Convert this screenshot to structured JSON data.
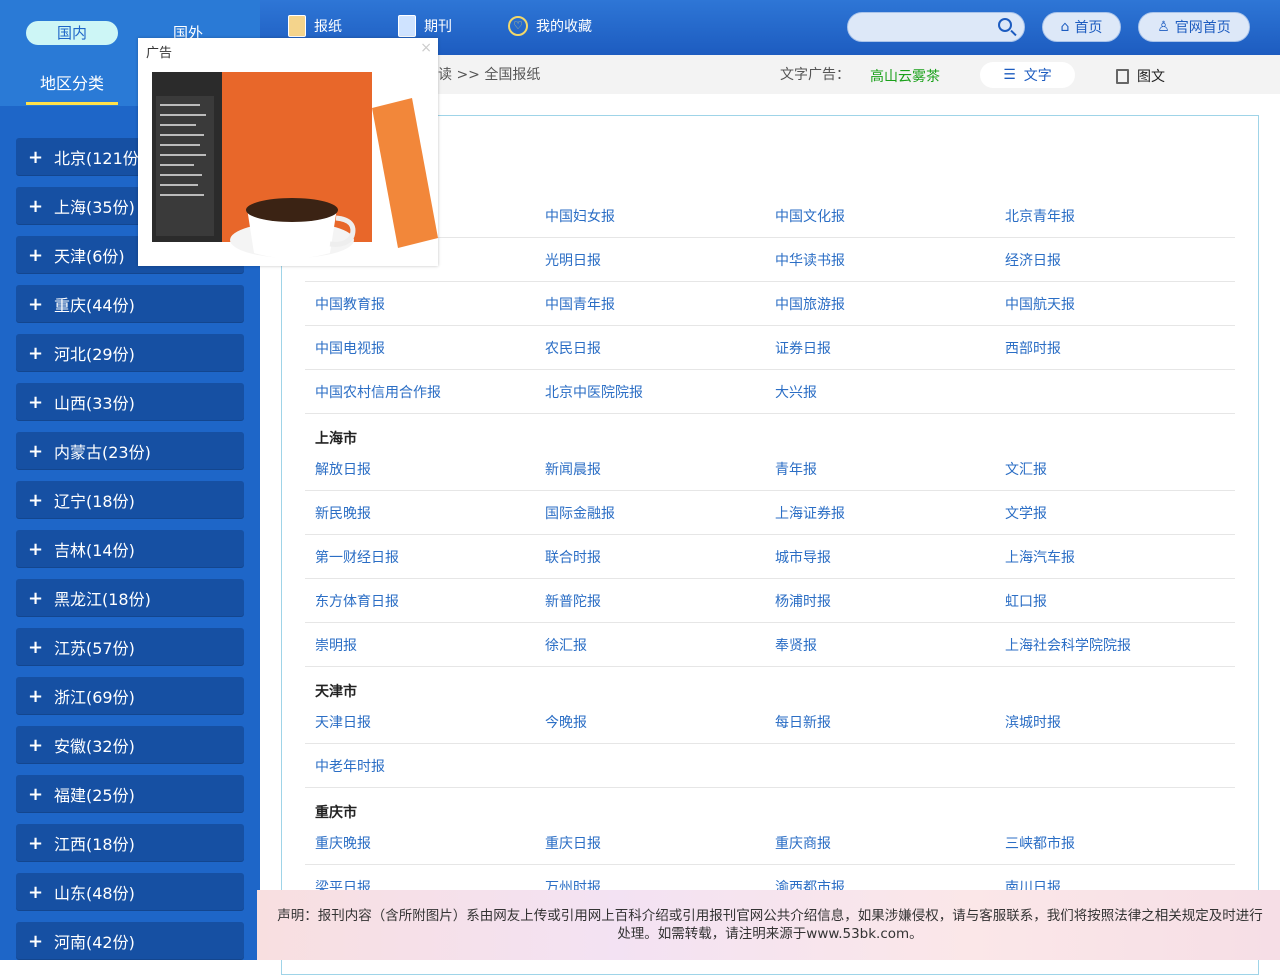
{
  "sidebar": {
    "tabs": {
      "domestic": "国内",
      "foreign": "国外"
    },
    "sub_label": "地区分类",
    "provinces": [
      "北京(121份)",
      "上海(35份)",
      "天津(6份)",
      "重庆(44份)",
      "河北(29份)",
      "山西(33份)",
      "内蒙古(23份)",
      "辽宁(18份)",
      "吉林(14份)",
      "黑龙江(18份)",
      "江苏(57份)",
      "浙江(69份)",
      "安徽(32份)",
      "福建(25份)",
      "江西(18份)",
      "山东(48份)",
      "河南(42份)"
    ]
  },
  "nav": {
    "newspapers": "报纸",
    "periodicals": "期刊",
    "favorites": "我的收藏",
    "home": "首页",
    "official_home": "官网首页",
    "search_placeholder": ""
  },
  "crumb": {
    "breadcrumb": "读 >> 全国报纸",
    "ad_text_label": "文字广告：",
    "ad_text_link": "高山云雾茶",
    "view_text": "文字",
    "view_pic": "图文"
  },
  "ad": {
    "label": "广告",
    "close": "×"
  },
  "sections": {
    "beijing_rows": [
      [
        "",
        "中国妇女报",
        "中国文化报",
        "北京青年报"
      ],
      [
        "",
        "光明日报",
        "中华读书报",
        "经济日报"
      ],
      [
        "中国教育报",
        "中国青年报",
        "中国旅游报",
        "中国航天报"
      ],
      [
        "中国电视报",
        "农民日报",
        "证券日报",
        "西部时报"
      ],
      [
        "中国农村信用合作报",
        "北京中医院院报",
        "大兴报",
        ""
      ]
    ],
    "shanghai_title": "上海市",
    "shanghai_rows": [
      [
        "解放日报",
        "新闻晨报",
        "青年报",
        "文汇报"
      ],
      [
        "新民晚报",
        "国际金融报",
        "上海证券报",
        "文学报"
      ],
      [
        "第一财经日报",
        "联合时报",
        "城市导报",
        "上海汽车报"
      ],
      [
        "东方体育日报",
        "新普陀报",
        "杨浦时报",
        "虹口报"
      ],
      [
        "崇明报",
        "徐汇报",
        "奉贤报",
        "上海社会科学院院报"
      ]
    ],
    "tianjin_title": "天津市",
    "tianjin_rows": [
      [
        "天津日报",
        "今晚报",
        "每日新报",
        "滨城时报"
      ],
      [
        "中老年时报",
        "",
        "",
        ""
      ]
    ],
    "chongqing_title": "重庆市",
    "chongqing_rows": [
      [
        "重庆晚报",
        "重庆日报",
        "重庆商报",
        "三峡都市报"
      ],
      [
        "梁平日报",
        "万州时报",
        "渝西都市报",
        "南川日报"
      ]
    ]
  },
  "footer": {
    "text": "声明：报刊内容（含所附图片）系由网友上传或引用网上百科介绍或引用报刊官网公共介绍信息，如果涉嫌侵权，请与客服联系，我们将按照法律之相关规定及时进行处理。如需转载，请注明来源于www.53bk.com。"
  }
}
